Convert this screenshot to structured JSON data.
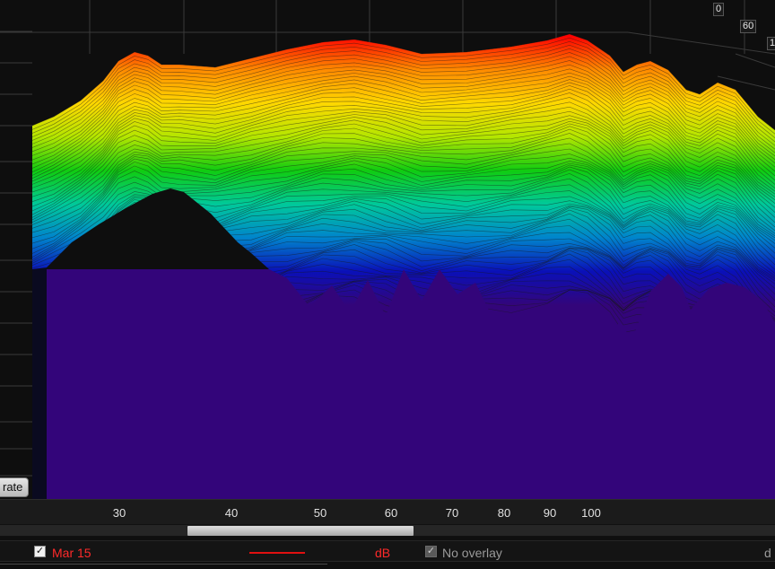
{
  "plot": {
    "colors": {
      "floor": "#33057a",
      "background": "#0e0e0e",
      "grid": "#3a3a3a",
      "ridge": "#1a1a1a"
    },
    "spectrum_bands": [
      "#ff0000",
      "#ff8a00",
      "#ffd800",
      "#b4e600",
      "#10cc10",
      "#00c99a",
      "#0084cc",
      "#0a10b8",
      "#33057a"
    ],
    "depth_axis": {
      "ticks": [
        "0",
        "60",
        "1"
      ]
    },
    "freq_axis": {
      "ticks": [
        "30",
        "40",
        "50",
        "60",
        "70",
        "80",
        "90",
        "100"
      ]
    }
  },
  "toolbar": {
    "calibrate_label": "rate"
  },
  "legend": {
    "measurement": {
      "checked": true,
      "check_glyph": "✓",
      "name": "Mar 15",
      "color": "#e01010",
      "unit": "dB"
    },
    "overlay": {
      "checked": true,
      "check_glyph": "✓",
      "label": "No overlay",
      "disabled": true
    },
    "trailing_text": "d"
  }
}
